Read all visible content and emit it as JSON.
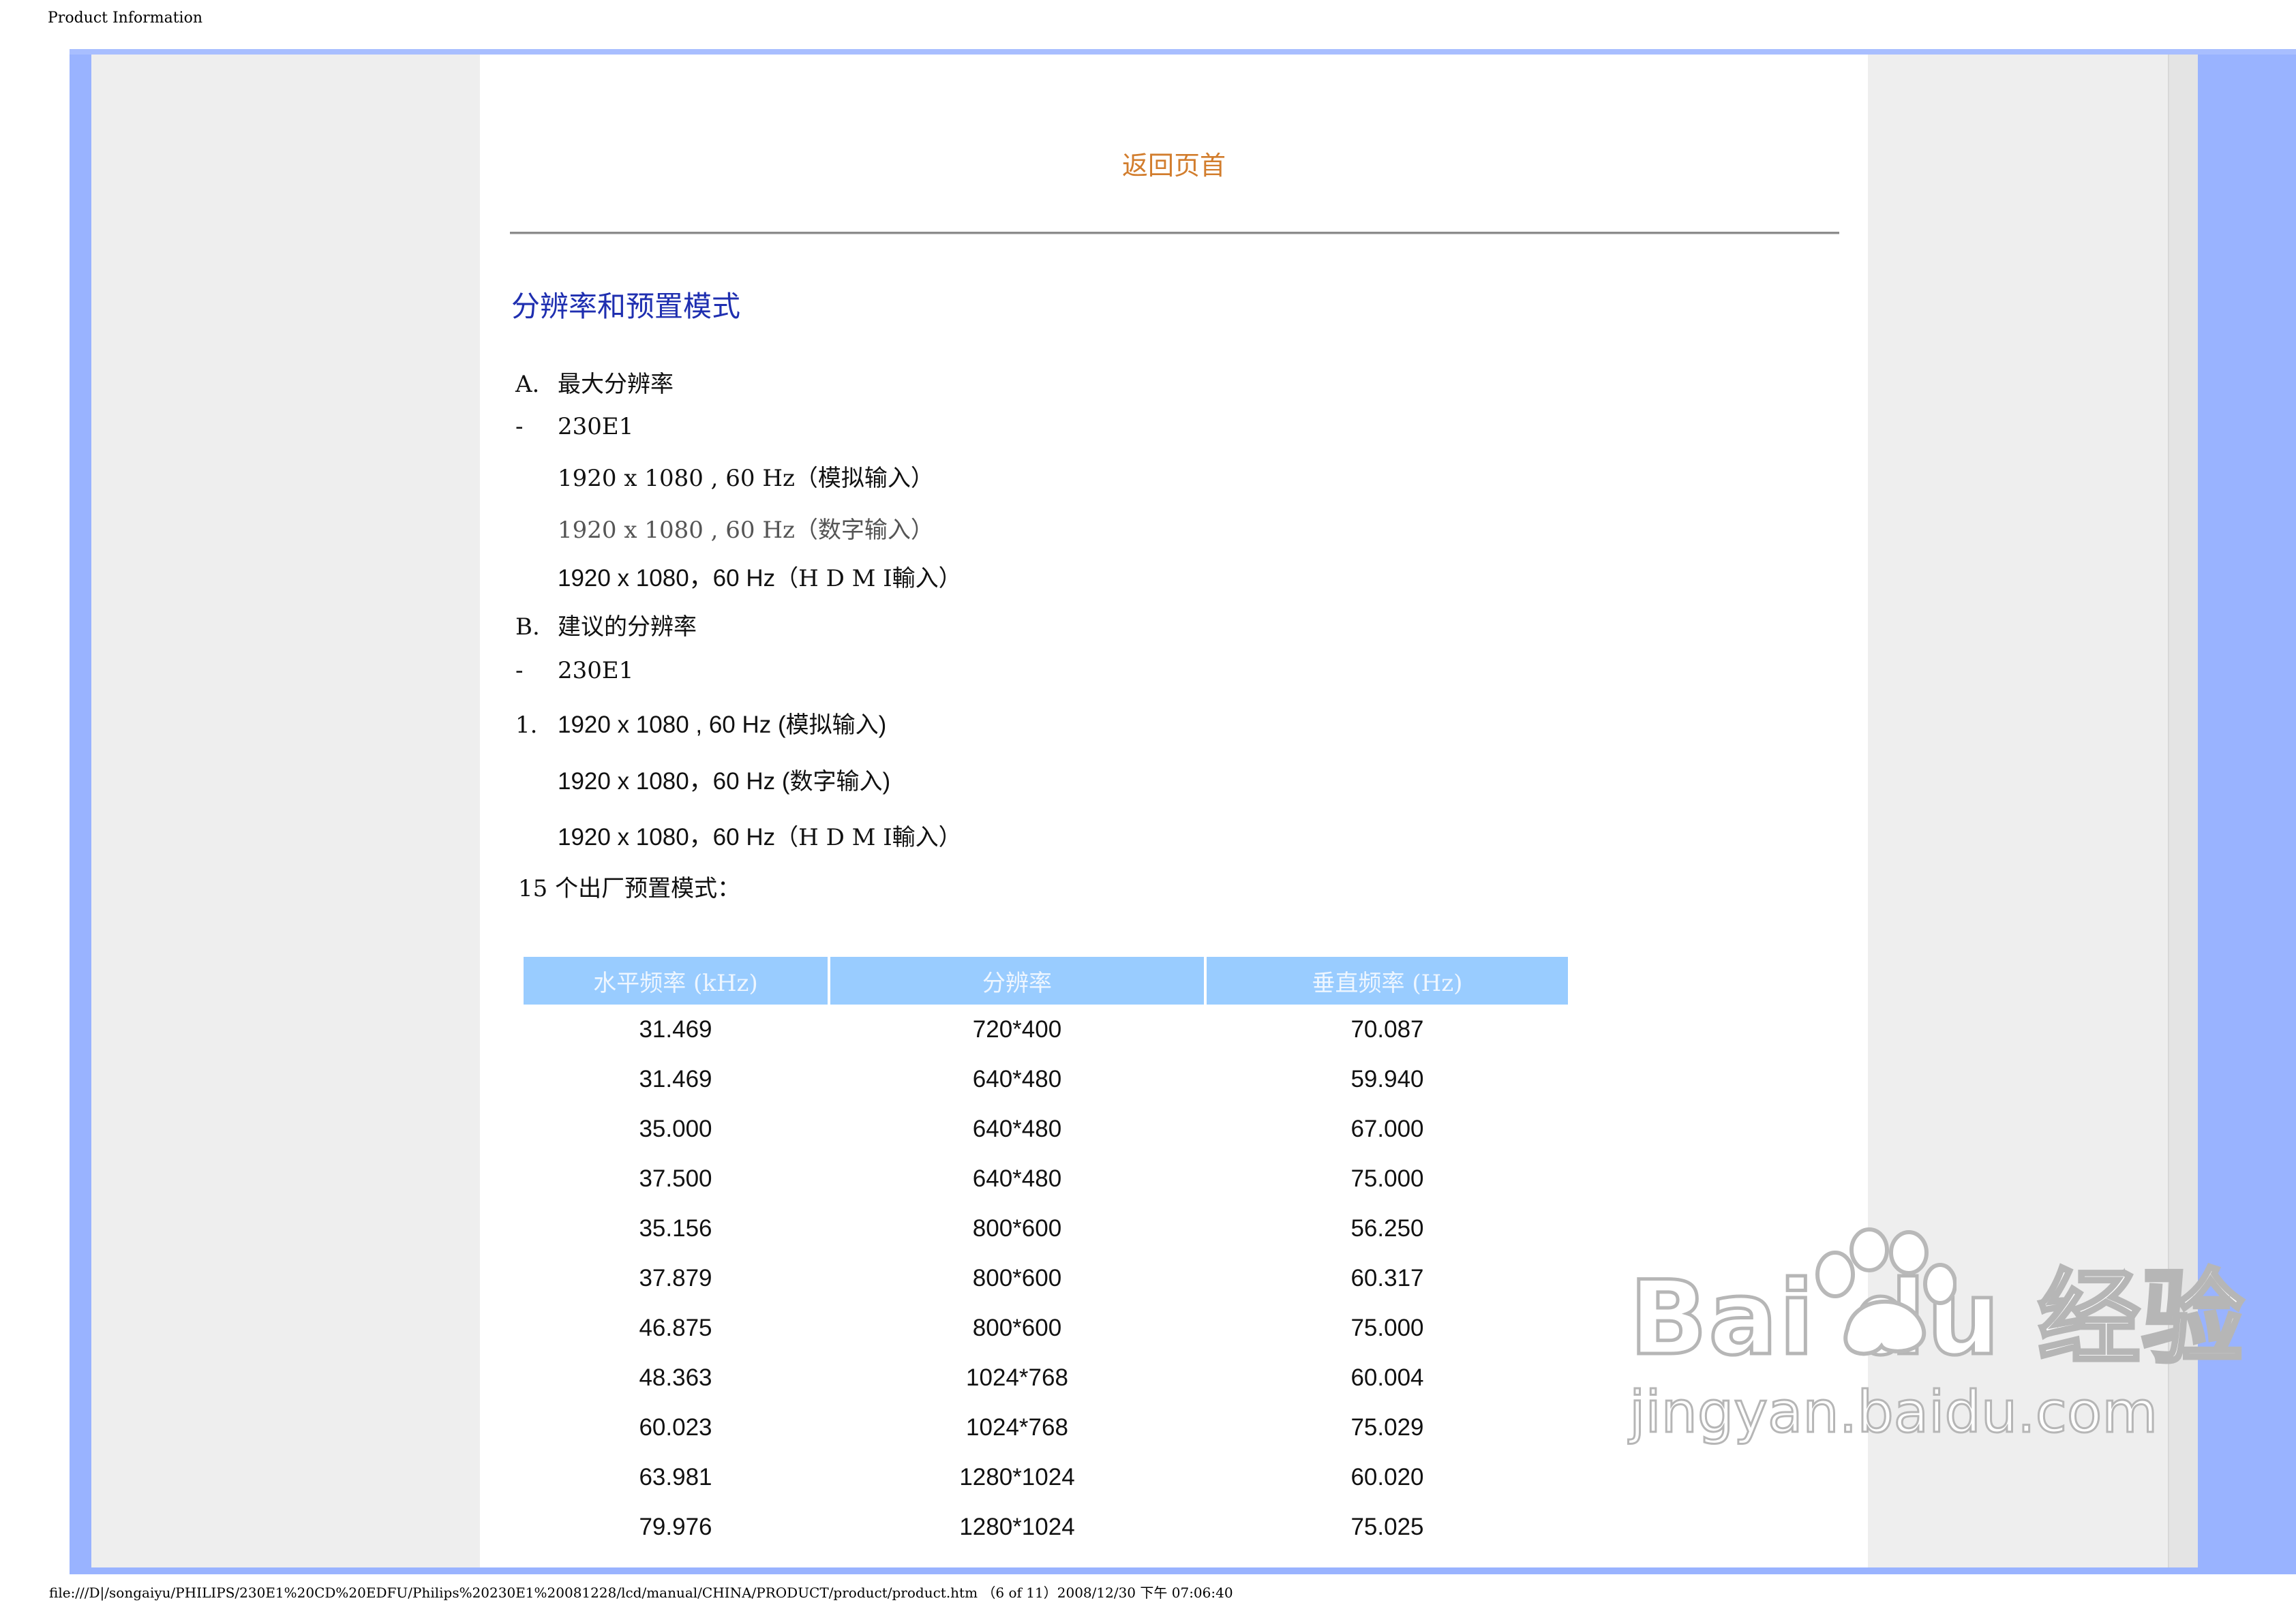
{
  "header": {
    "title": "Product Information"
  },
  "nav": {
    "back_link": "返回页首"
  },
  "section": {
    "title": "分辨率和预置模式"
  },
  "max_res": {
    "marker": "A.",
    "heading": "最大分辨率",
    "dash": "-",
    "model": "230E1",
    "line1": "1920  x  1080  ,  60  Hz（模拟输入）",
    "line2": "1920  x  1080  ,  60  Hz（数字输入）",
    "line3a": "1920 x 1080，60 Hz",
    "line3b": "（H D M I輸入）"
  },
  "rec_res": {
    "marker": "B.",
    "heading": "建议的分辨率",
    "dash": "-",
    "model": "230E1",
    "num": "1.",
    "line1a": "1920 x 1080 , 60 Hz (",
    "line1b": "模拟输入",
    "line1c": ")",
    "line2a": "1920 x 1080，60 Hz (",
    "line2b": "数字输入",
    "line2c": ")",
    "line3a": "1920 x 1080，60 Hz",
    "line3b": "（H D M I輸入）"
  },
  "presets": {
    "label": "15 个出厂预置模式："
  },
  "table": {
    "headers": [
      "水平频率 (kHz)",
      "分辨率",
      "垂直频率 (Hz)"
    ],
    "rows": [
      [
        "31.469",
        "720*400",
        "70.087"
      ],
      [
        "31.469",
        "640*480",
        "59.940"
      ],
      [
        "35.000",
        "640*480",
        "67.000"
      ],
      [
        "37.500",
        "640*480",
        "75.000"
      ],
      [
        "35.156",
        "800*600",
        "56.250"
      ],
      [
        "37.879",
        "800*600",
        "60.317"
      ],
      [
        "46.875",
        "800*600",
        "75.000"
      ],
      [
        "48.363",
        "1024*768",
        "60.004"
      ],
      [
        "60.023",
        "1024*768",
        "75.029"
      ],
      [
        "63.981",
        "1280*1024",
        "60.020"
      ],
      [
        "79.976",
        "1280*1024",
        "75.025"
      ]
    ]
  },
  "watermark": {
    "brand": "Bai du 经验",
    "url": "jingyan.baidu.com"
  },
  "footer": {
    "path": "file:///D|/songaiyu/PHILIPS/230E1%20CD%20EDFU/Philips%20230E1%20081228/lcd/manual/CHINA/PRODUCT/product/product.htm （6 of 11）2008/12/30 下午 07:06:40"
  }
}
